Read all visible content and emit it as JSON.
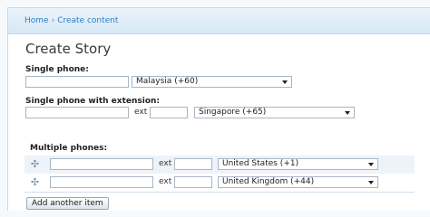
{
  "breadcrumb": {
    "home": "Home",
    "separator": "›",
    "current": "Create content"
  },
  "page_title": "Create Story",
  "single_phone": {
    "label": "Single phone:",
    "number_value": "",
    "country": "Malaysia (+60)"
  },
  "single_phone_ext": {
    "label": "Single phone with extension:",
    "number_value": "",
    "ext_label": "ext",
    "ext_value": "",
    "country": "Singapore (+65)"
  },
  "multiple_phones": {
    "label": "Multiple phones:",
    "drag_glyph": "✣",
    "rows": [
      {
        "number_value": "",
        "ext_label": "ext",
        "ext_value": "",
        "country": "United States (+1)"
      },
      {
        "number_value": "",
        "ext_label": "ext",
        "ext_value": "",
        "country": "United Kingdom (+44)"
      }
    ],
    "add_button": "Add another item"
  },
  "colors": {
    "link": "#2d7fc1",
    "row_alt": "#eef3f9",
    "header_bg": "#d6e8f6"
  }
}
